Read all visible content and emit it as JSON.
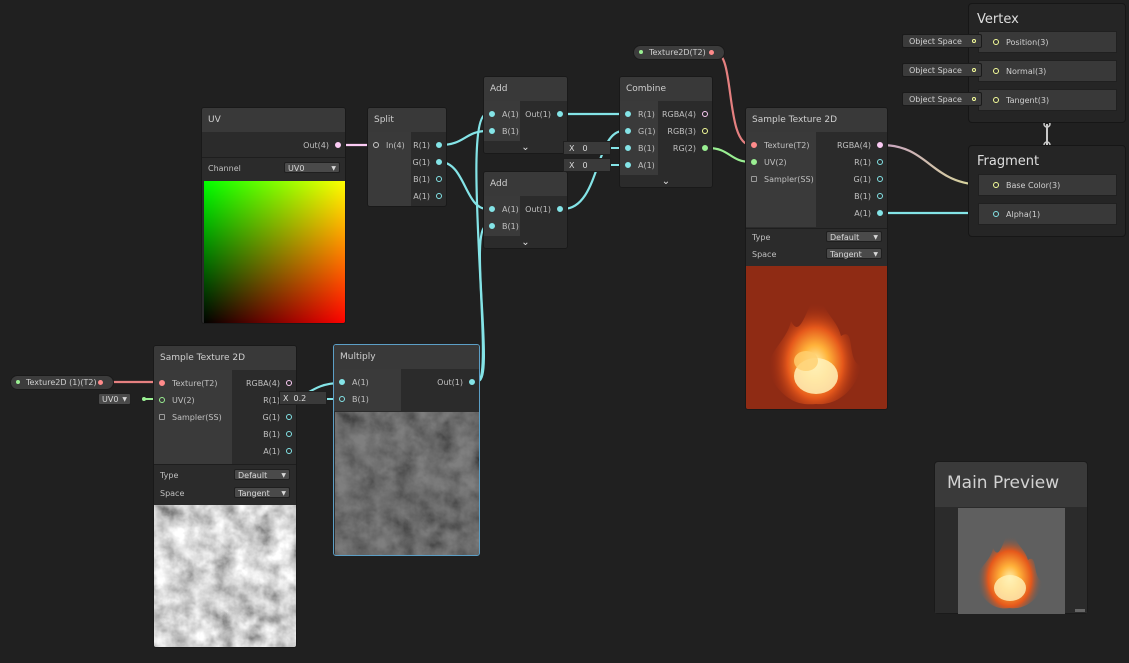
{
  "colors": {
    "vector1": "#84e4e7",
    "vector2": "#9aef92",
    "vector3": "#f6ff9a",
    "vector4": "#fbcbf4",
    "texture": "#ff8b8b",
    "selection": "#5c9fc6",
    "background": "#202020"
  },
  "nodes": {
    "uv": {
      "title": "UV",
      "out": "Out(4)",
      "channel_label": "Channel",
      "channel_value": "UV0"
    },
    "split": {
      "title": "Split",
      "in": "In(4)",
      "outs": [
        "R(1)",
        "G(1)",
        "B(1)",
        "A(1)"
      ]
    },
    "add1": {
      "title": "Add",
      "ins": [
        "A(1)",
        "B(1)"
      ],
      "out": "Out(1)"
    },
    "add2": {
      "title": "Add",
      "ins": [
        "A(1)",
        "B(1)"
      ],
      "out": "Out(1)"
    },
    "combine": {
      "title": "Combine",
      "ins": [
        "R(1)",
        "G(1)",
        "B(1)",
        "A(1)"
      ],
      "outs": [
        "RGBA(4)",
        "RGB(3)",
        "RG(2)"
      ],
      "b_inline_label": "X",
      "b_inline_value": "0",
      "a_inline_label": "X",
      "a_inline_value": "0"
    },
    "sample_main": {
      "title": "Sample Texture 2D",
      "ins": [
        "Texture(T2)",
        "UV(2)",
        "Sampler(SS)"
      ],
      "outs": [
        "RGBA(4)",
        "R(1)",
        "G(1)",
        "B(1)",
        "A(1)"
      ],
      "type_label": "Type",
      "type_value": "Default",
      "space_label": "Space",
      "space_value": "Tangent"
    },
    "sample_noise": {
      "title": "Sample Texture 2D",
      "ins": [
        "Texture(T2)",
        "UV(2)",
        "Sampler(SS)"
      ],
      "outs": [
        "RGBA(4)",
        "R(1)",
        "G(1)",
        "B(1)",
        "A(1)"
      ],
      "type_label": "Type",
      "type_value": "Default",
      "space_label": "Space",
      "space_value": "Tangent",
      "uv_default": "UV0"
    },
    "multiply": {
      "title": "Multiply",
      "ins": [
        "A(1)",
        "B(1)"
      ],
      "out": "Out(1)",
      "b_inline_label": "X",
      "b_inline_value": "0.2"
    }
  },
  "properties": {
    "tex_top": "Texture2D(T2)",
    "tex_bottom": "Texture2D (1)(T2)"
  },
  "vertex": {
    "title": "Vertex",
    "slots": [
      {
        "label": "Position(3)",
        "space": "Object Space"
      },
      {
        "label": "Normal(3)",
        "space": "Object Space"
      },
      {
        "label": "Tangent(3)",
        "space": "Object Space"
      }
    ]
  },
  "fragment": {
    "title": "Fragment",
    "slots": [
      "Base Color(3)",
      "Alpha(1)"
    ]
  },
  "main_preview": {
    "title": "Main Preview"
  }
}
